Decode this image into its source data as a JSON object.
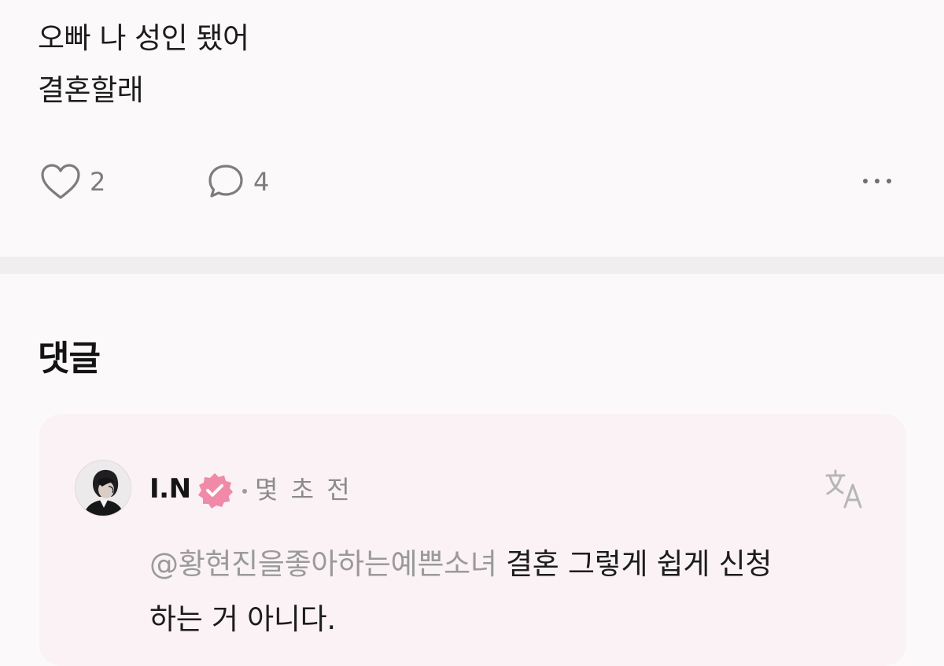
{
  "post": {
    "lines": [
      "오빠 나 성인 됐어",
      "결혼할래"
    ],
    "likes_count": "2",
    "comments_count": "4"
  },
  "comments_section": {
    "title": "댓글",
    "comments": [
      {
        "username": "I.N",
        "verified": true,
        "time_ago": "몇 초 전",
        "mention": "@황현진을좋아하는예쁜소녀",
        "text_first": " 결혼 그렇게 쉽게 신청",
        "text_second": "하는 거 아니다."
      }
    ]
  },
  "colors": {
    "badge": "#f08aa8",
    "card_background": "#fbf2f5",
    "mention": "#9a9a9a"
  },
  "icons": {
    "like": "heart-icon",
    "comment": "speech-bubble-icon",
    "more": "more-horizontal-icon",
    "translate": "translate-icon",
    "verified": "verified-badge-icon"
  }
}
